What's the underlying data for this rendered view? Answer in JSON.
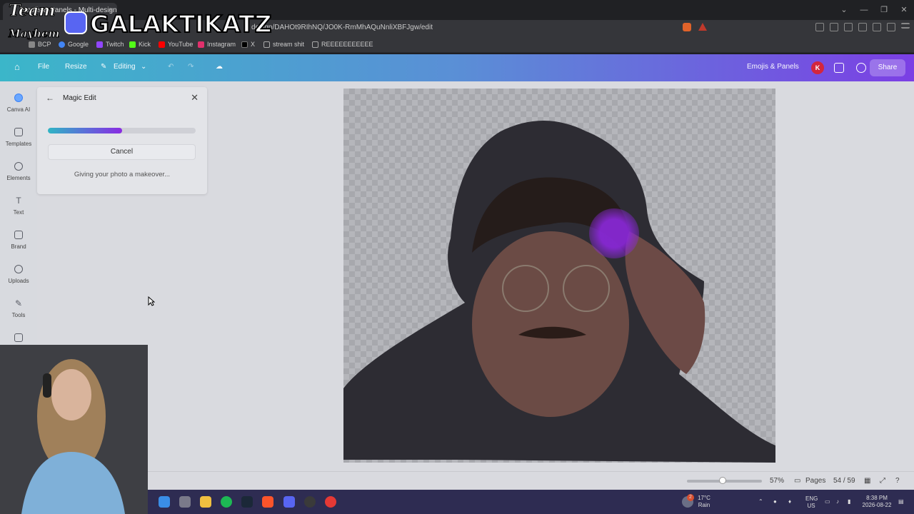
{
  "browser": {
    "tab_title": "Emojis & Panels - Multi-design",
    "tab_close": "×",
    "url": "design/DAHOt9RIhNQ/JO0K-RmMhAQuNnliXBFJgw/edit",
    "window_controls": [
      "⌄",
      "—",
      "❐",
      "✕"
    ]
  },
  "bookmarks": [
    {
      "label": "BCP",
      "color": "#888888"
    },
    {
      "label": "Google",
      "color": "#4285f4"
    },
    {
      "label": "Twitch",
      "color": "#9146ff"
    },
    {
      "label": "Kick",
      "color": "#53fc18"
    },
    {
      "label": "YouTube",
      "color": "#ff0000"
    },
    {
      "label": "Instagram",
      "color": "#e1306c"
    },
    {
      "label": "X",
      "color": "#000000"
    },
    {
      "label": "stream shit",
      "color": "#aaaaaa"
    },
    {
      "label": "REEEEEEEEEEE",
      "color": "#aaaaaa"
    }
  ],
  "toolbar": {
    "home_icon": "home-icon",
    "file": "File",
    "resize": "Resize",
    "editing": "Editing",
    "design_name": "Emojis & Panels",
    "avatar_initial": "K",
    "share": "Share"
  },
  "rail": [
    {
      "label": "Canva AI",
      "icon": "canva-ai-icon"
    },
    {
      "label": "Templates",
      "icon": "templates-icon"
    },
    {
      "label": "Elements",
      "icon": "elements-icon"
    },
    {
      "label": "Text",
      "icon": "text-icon"
    },
    {
      "label": "Brand",
      "icon": "brand-icon"
    },
    {
      "label": "Uploads",
      "icon": "uploads-icon"
    },
    {
      "label": "Tools",
      "icon": "tools-icon"
    },
    {
      "label": "",
      "icon": "folder-icon"
    }
  ],
  "magic_edit": {
    "back": "←",
    "title": "Magic Edit",
    "close": "✕",
    "progress": 0.5,
    "cancel": "Cancel",
    "status": "Giving your photo a makeover..."
  },
  "bottom_bar": {
    "zoom": "57%",
    "pages_label": "Pages",
    "page_counter": "54 / 59"
  },
  "taskbar": {
    "weather_temp": "17°C",
    "weather_desc": "Rain",
    "lang_top": "ENG",
    "lang_bottom": "US",
    "time": "8:38 PM",
    "date": "2026-08-22",
    "weather_badge": "2"
  },
  "overlay": {
    "team_line1": "Team",
    "team_line2": "Mayhem",
    "channel": "GALAKTIKATZ"
  },
  "colors": {
    "canva_gradient_start": "#3bb6c9",
    "canva_gradient_end": "#7b3fe4",
    "avatar_bg": "#d3263d",
    "discord": "#5865f2"
  }
}
